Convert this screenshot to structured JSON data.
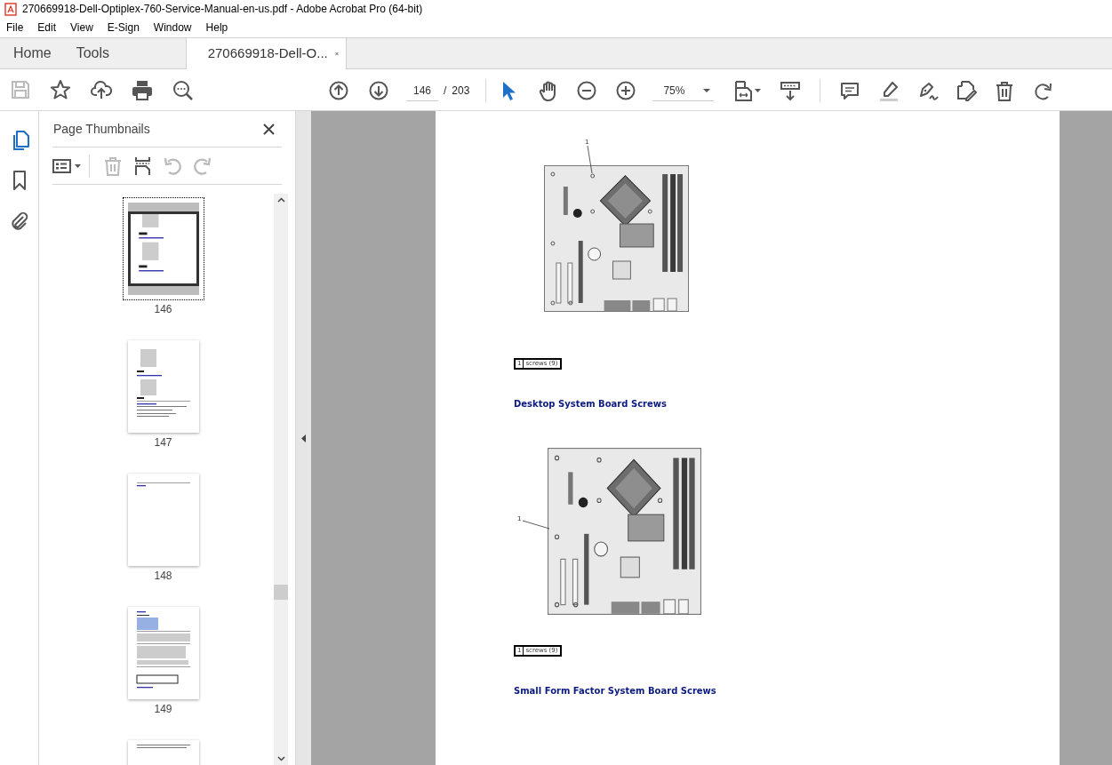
{
  "window": {
    "title": "270669918-Dell-Optiplex-760-Service-Manual-en-us.pdf - Adobe Acrobat Pro (64-bit)"
  },
  "menu": [
    "File",
    "Edit",
    "View",
    "E-Sign",
    "Window",
    "Help"
  ],
  "tabs": [
    {
      "label": "Home",
      "selected": false,
      "kind": "nav"
    },
    {
      "label": "Tools",
      "selected": false,
      "kind": "nav"
    },
    {
      "label": "270669918-Dell-O...",
      "selected": true,
      "kind": "document"
    }
  ],
  "toolbar": {
    "page_number": "146",
    "page_separator": "/",
    "page_count": "203",
    "zoom": "75%"
  },
  "side_rail": [
    {
      "kind": "pages",
      "selected": true
    },
    {
      "kind": "bookmarks",
      "selected": false
    },
    {
      "kind": "attachments",
      "selected": false
    }
  ],
  "panel": {
    "title": "Page Thumbnails",
    "thumbnails": [
      {
        "label": "146",
        "selected": true
      },
      {
        "label": "147",
        "selected": false
      },
      {
        "label": "148",
        "selected": false
      },
      {
        "label": "149",
        "selected": false
      },
      {
        "selected": false
      }
    ]
  },
  "document": {
    "figures": [
      {
        "kind": "desktop",
        "callout": "1",
        "legend_number": "1",
        "legend_text": "screws (9)",
        "caption": "Desktop System Board Screws"
      },
      {
        "kind": "small_form_factor",
        "callout": "1",
        "legend_number": "1",
        "legend_text": "screws (9)",
        "caption": "Small Form Factor System Board Screws"
      }
    ]
  }
}
